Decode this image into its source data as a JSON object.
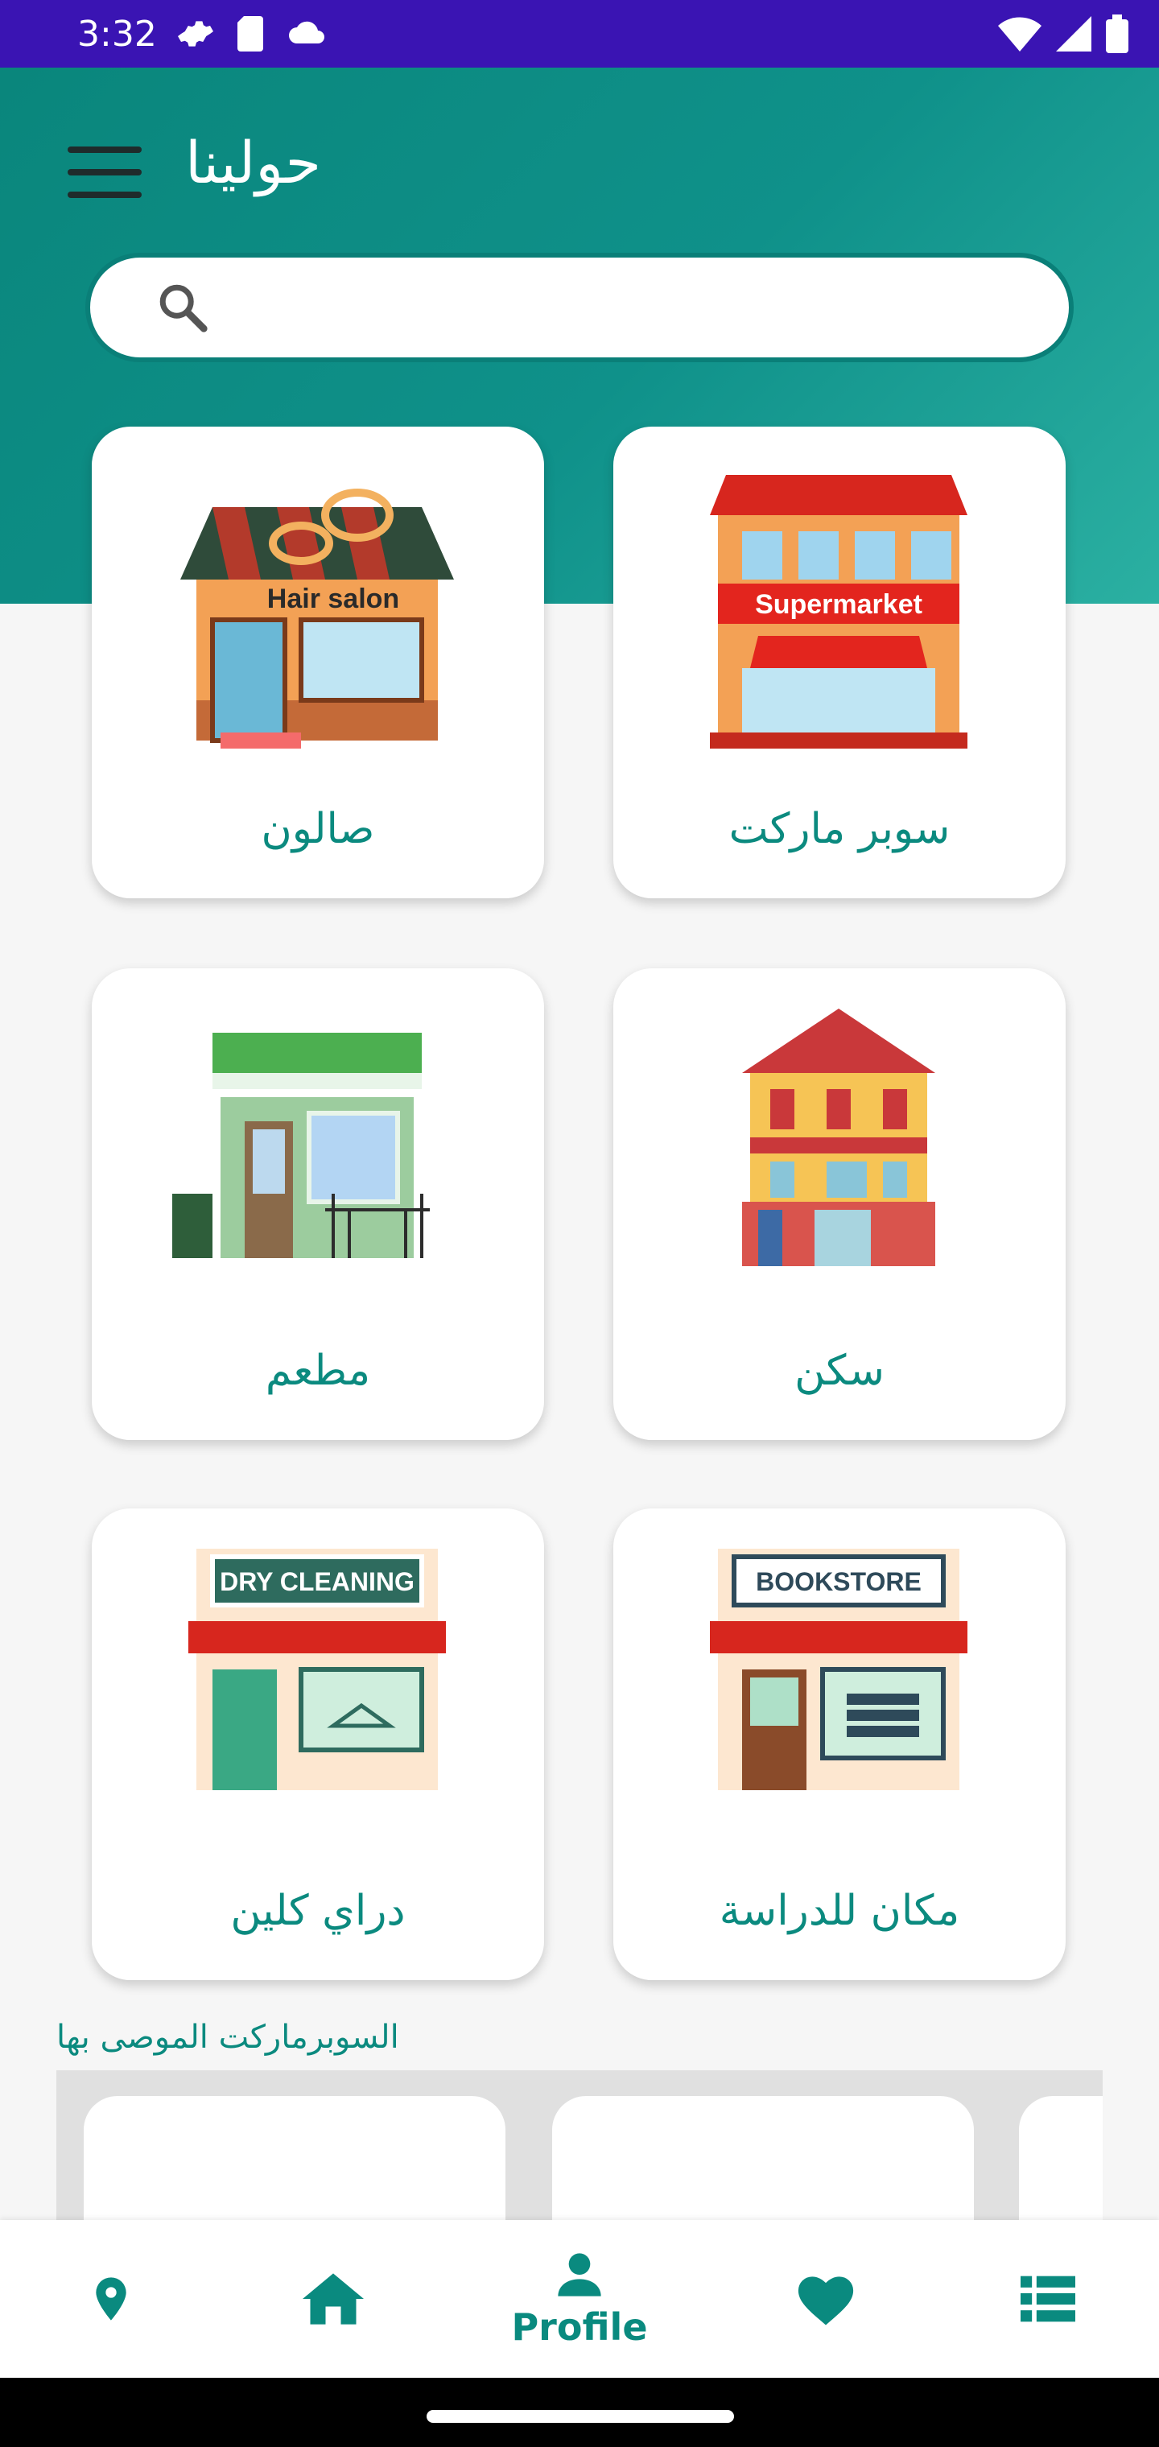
{
  "status_bar": {
    "time": "3:32"
  },
  "header": {
    "app_title": "حولينا"
  },
  "search": {
    "placeholder": ""
  },
  "categories": [
    {
      "label": "صالون",
      "sign": "Hair salon"
    },
    {
      "label": "سوبر ماركت",
      "sign": "Supermarket"
    },
    {
      "label": "مطعم"
    },
    {
      "label": "سكن"
    },
    {
      "label": "دراي كلين",
      "sign": "DRY CLEANING"
    },
    {
      "label": "مكان للدراسة",
      "sign": "BOOKSTORE"
    }
  ],
  "recommended": {
    "title": "السوبرماركت الموصى بها"
  },
  "bottom_nav": {
    "items": [
      {
        "icon": "location-icon"
      },
      {
        "icon": "home-icon"
      },
      {
        "icon": "profile-icon",
        "label": "Profile",
        "active": true
      },
      {
        "icon": "heart-icon"
      },
      {
        "icon": "list-icon"
      }
    ]
  },
  "colors": {
    "accent": "#0a8a7f",
    "status_bar": "#3a14b3"
  }
}
